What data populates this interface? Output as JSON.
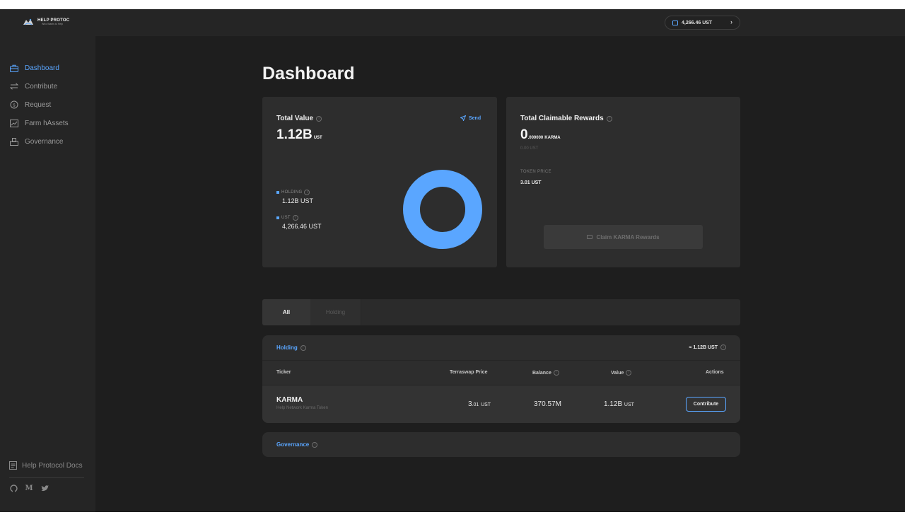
{
  "brand": {
    "title": "HELP PROTOC",
    "subtitle": "Who Wants to Help"
  },
  "sidebar": {
    "items": [
      {
        "label": "Dashboard",
        "icon": "briefcase-icon",
        "active": true
      },
      {
        "label": "Contribute",
        "icon": "arrows-swap-icon",
        "active": false
      },
      {
        "label": "Request",
        "icon": "coin-refresh-icon",
        "active": false
      },
      {
        "label": "Farm hAssets",
        "icon": "chart-icon",
        "active": false
      },
      {
        "label": "Governance",
        "icon": "ballot-box-icon",
        "active": false
      }
    ],
    "docs_label": "Help Protocol Docs",
    "socials": [
      "github-icon",
      "medium-icon",
      "twitter-icon"
    ],
    "medium_glyph": "M"
  },
  "topbar": {
    "wallet_balance": "4,266.46 UST",
    "chevron": "›"
  },
  "page": {
    "title": "Dashboard"
  },
  "total_value": {
    "title": "Total Value",
    "send_label": "Send",
    "value": "1.12B",
    "unit": "UST",
    "legend": [
      {
        "label": "HOLDING",
        "value": "1.12B UST"
      },
      {
        "label": "UST",
        "value": "4,266.46 UST"
      }
    ],
    "donut_share_holding": 0.999996,
    "accent": "#5aa6ff"
  },
  "rewards": {
    "title": "Total Claimable Rewards",
    "value_int": "0",
    "value_dec": ".000000",
    "unit": "KARMA",
    "sub": "0.00 UST",
    "token_price_label": "TOKEN PRICE",
    "token_price": "3.01 UST",
    "claim_label": "Claim KARMA Rewards"
  },
  "tabs": [
    {
      "label": "All",
      "active": true
    },
    {
      "label": "Holding",
      "active": false
    }
  ],
  "holding": {
    "title": "Holding",
    "total": "≈ 1.12B UST",
    "columns": {
      "ticker": "Ticker",
      "price": "Terraswap Price",
      "balance": "Balance",
      "value": "Value",
      "actions": "Actions"
    },
    "rows": [
      {
        "ticker": "KARMA",
        "name": "Help Network Karma Token",
        "price": "3",
        "price_dec": ".01",
        "price_unit": "UST",
        "balance": "370.57M",
        "value": "1.12B",
        "value_unit": "UST",
        "action": "Contribute"
      }
    ]
  },
  "governance": {
    "title": "Governance"
  }
}
